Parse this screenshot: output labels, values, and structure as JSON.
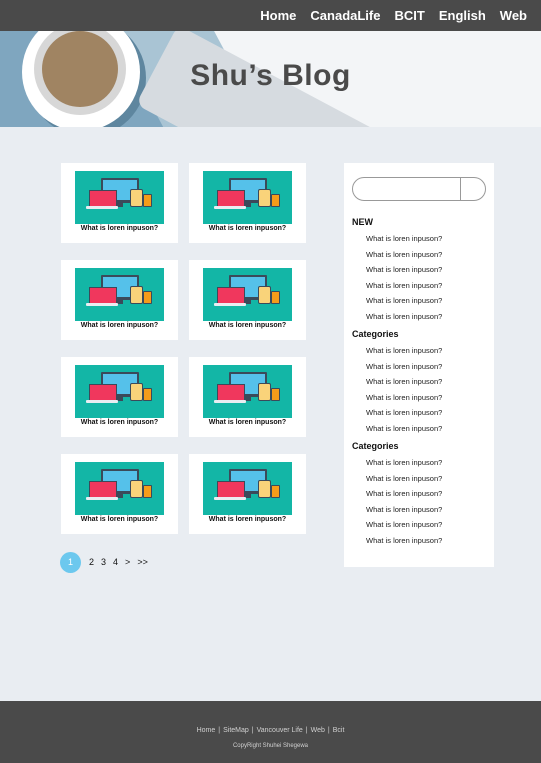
{
  "nav": {
    "items": [
      "Home",
      "CanadaLife",
      "BCIT",
      "English",
      "Web"
    ]
  },
  "hero": {
    "title": "Shu’s Blog"
  },
  "posts": [
    {
      "label": "What is loren inpuson?"
    },
    {
      "label": "What is loren inpuson?"
    },
    {
      "label": "What is loren inpuson?"
    },
    {
      "label": "What is loren inpuson?"
    },
    {
      "label": "What is loren inpuson?"
    },
    {
      "label": "What is loren inpuson?"
    },
    {
      "label": "What is loren inpuson?"
    },
    {
      "label": "What is loren inpuson?"
    }
  ],
  "sidebar": {
    "search_placeholder": "",
    "sections": [
      {
        "title": "NEW",
        "items": [
          "What is loren inpuson?",
          "What is loren inpuson?",
          "What is loren inpuson?",
          "What is loren inpuson?",
          "What is loren inpuson?",
          "What is loren inpuson?"
        ]
      },
      {
        "title": "Categories",
        "items": [
          "What is loren inpuson?",
          "What is loren inpuson?",
          "What is loren inpuson?",
          "What is loren inpuson?",
          "What is loren inpuson?",
          "What is loren inpuson?"
        ]
      },
      {
        "title": "Categories",
        "items": [
          "What is loren inpuson?",
          "What is loren inpuson?",
          "What is loren inpuson?",
          "What is loren inpuson?",
          "What is loren inpuson?",
          "What is loren inpuson?"
        ]
      }
    ]
  },
  "pagination": {
    "current": "1",
    "pages": [
      "2",
      "3",
      "4"
    ],
    "next": ">",
    "last": ">>"
  },
  "footer": {
    "links": [
      "Home",
      "SiteMap",
      "Vancouver Life",
      "Web",
      "Bcit"
    ],
    "copyright": "CopyRight Shuhei Shegewa"
  },
  "colors": {
    "nav_bg": "#4a4a4a",
    "page_bg": "#e9edf2",
    "thumb_teal": "#13b6a6",
    "pager_active": "#6cc8ee"
  }
}
